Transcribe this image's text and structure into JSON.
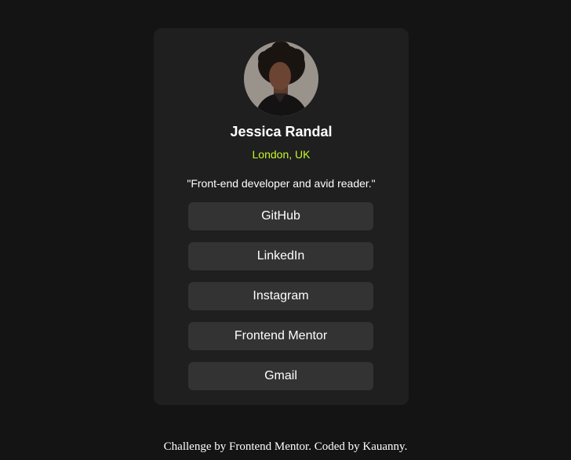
{
  "profile": {
    "name": "Jessica Randal",
    "location": "London, UK",
    "bio": "\"Front-end developer and avid reader.\""
  },
  "links": [
    {
      "label": "GitHub"
    },
    {
      "label": "LinkedIn"
    },
    {
      "label": "Instagram"
    },
    {
      "label": "Frontend Mentor"
    },
    {
      "label": "Gmail"
    }
  ],
  "footer": {
    "text": "Challenge by Frontend Mentor. Coded by Kauanny."
  },
  "colors": {
    "background": "#141414",
    "card": "#1f1f1f",
    "button": "#333333",
    "accent": "#c4f82a",
    "text": "#ffffff"
  }
}
